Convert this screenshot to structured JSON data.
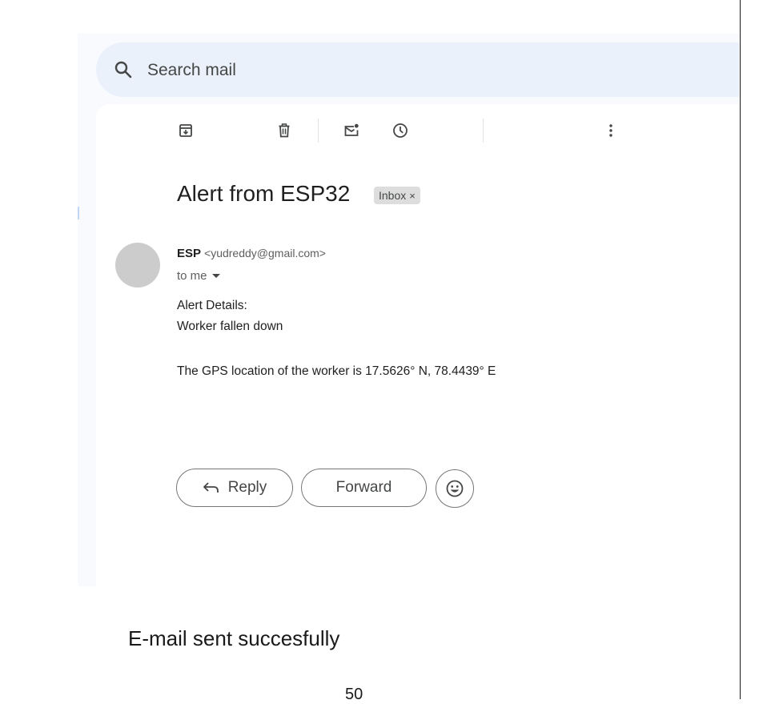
{
  "search": {
    "placeholder": "Search mail",
    "icon": "search-icon"
  },
  "toolbar": {
    "items": [
      {
        "name": "archive",
        "icon": "archive-icon"
      },
      {
        "name": "delete",
        "icon": "trash-icon"
      },
      {
        "name": "mark-unread",
        "icon": "mark-unread-icon"
      },
      {
        "name": "snooze",
        "icon": "clock-icon"
      },
      {
        "name": "more",
        "icon": "more-vert-icon"
      }
    ]
  },
  "email": {
    "subject": "Alert from ESP32",
    "label": "Inbox",
    "label_remove": "×",
    "sender_name": "ESP",
    "sender_email": "<yudreddy@gmail.com>",
    "recipient": "to me",
    "body": {
      "line1": "Alert Details:",
      "line2": "Worker fallen down",
      "line3": "The GPS location of the worker is 17.5626° N, 78.4439° E"
    }
  },
  "actions": {
    "reply": "Reply",
    "forward": "Forward",
    "emoji_icon": "emoji-icon"
  },
  "document": {
    "caption": "E-mail sent succesfully",
    "page_number": "50"
  },
  "colors": {
    "search_bg": "#eaf1fb",
    "app_bg": "#f8fafd",
    "avatar": "#cccccc",
    "badge_bg": "#dddddd"
  }
}
